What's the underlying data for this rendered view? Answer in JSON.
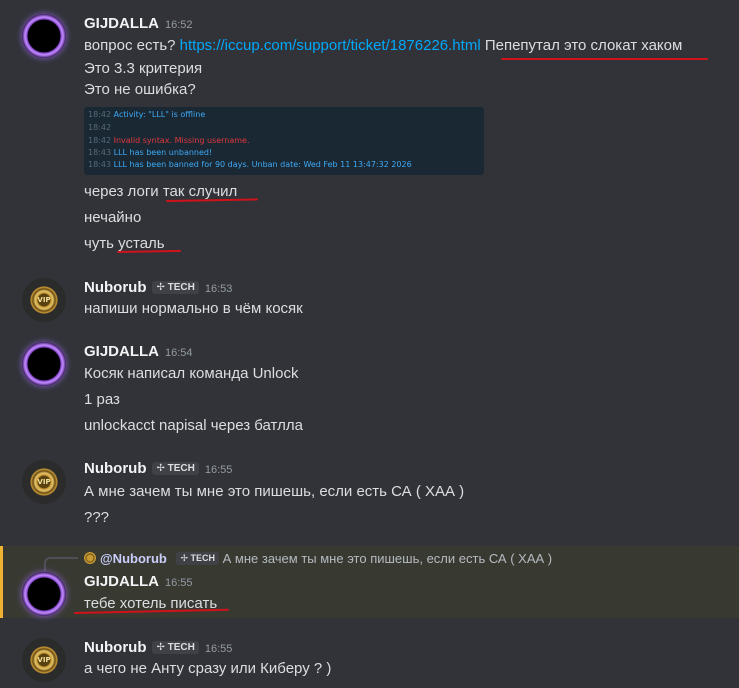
{
  "colors": {
    "background": "#313338",
    "link": "#00a8fc",
    "underline": "#d0121a",
    "highlight_bar": "#f0b232"
  },
  "messages": [
    {
      "author": "GIJDALLA",
      "time": "16:52",
      "lines": {
        "l1_prefix": "вопрос есть? ",
        "l1_link": "https://iccup.com/support/ticket/1876226.html",
        "l1_suffix": " Пепепутал это слокат хаком",
        "l2": "Это 3.3 критерия",
        "l3": "Это не ошибка?"
      },
      "log": {
        "r1_time": "18:42",
        "r1_text": "Activity: \"LLL\" is offline",
        "r2_time": "18:42",
        "r3_time": "18:42",
        "r3_text": "Invalid syntax. Missing username.",
        "r4_time": "18:43",
        "r4_text": "LLL has been unbanned!",
        "r5_time": "18:43",
        "r5_text": "LLL has been banned for 90 days. Unban date: Wed Feb 11 13:47:32 2026"
      },
      "after": {
        "l4": "через логи так случил",
        "l5": "нечайно",
        "l6": "чуть усталь"
      }
    },
    {
      "author": "Nuborub",
      "tag": "TECH",
      "time": "16:53",
      "text": "напиши нормально в чём косяк"
    },
    {
      "author": "GIJDALLA",
      "time": "16:54",
      "l1": "Косяк написал команда Unlock",
      "l2": "1 раз",
      "l3": "unlockacct napisal  через батлла"
    },
    {
      "author": "Nuborub",
      "tag": "TECH",
      "time": "16:55",
      "l1": "А  мне зачем ты мне это пишешь, если есть СА ( ХАА )",
      "l2": "???"
    },
    {
      "reply_mention": "@Nuborub",
      "reply_tag": "TECH",
      "reply_text": "А  мне зачем ты мне это пишешь, если есть СА ( ХАА )",
      "author": "GIJDALLA",
      "time": "16:55",
      "text": "тебе хотель писать"
    },
    {
      "author": "Nuborub",
      "tag": "TECH",
      "time": "16:55",
      "text": "а чего не Анту сразу или Киберу ? )"
    }
  ]
}
